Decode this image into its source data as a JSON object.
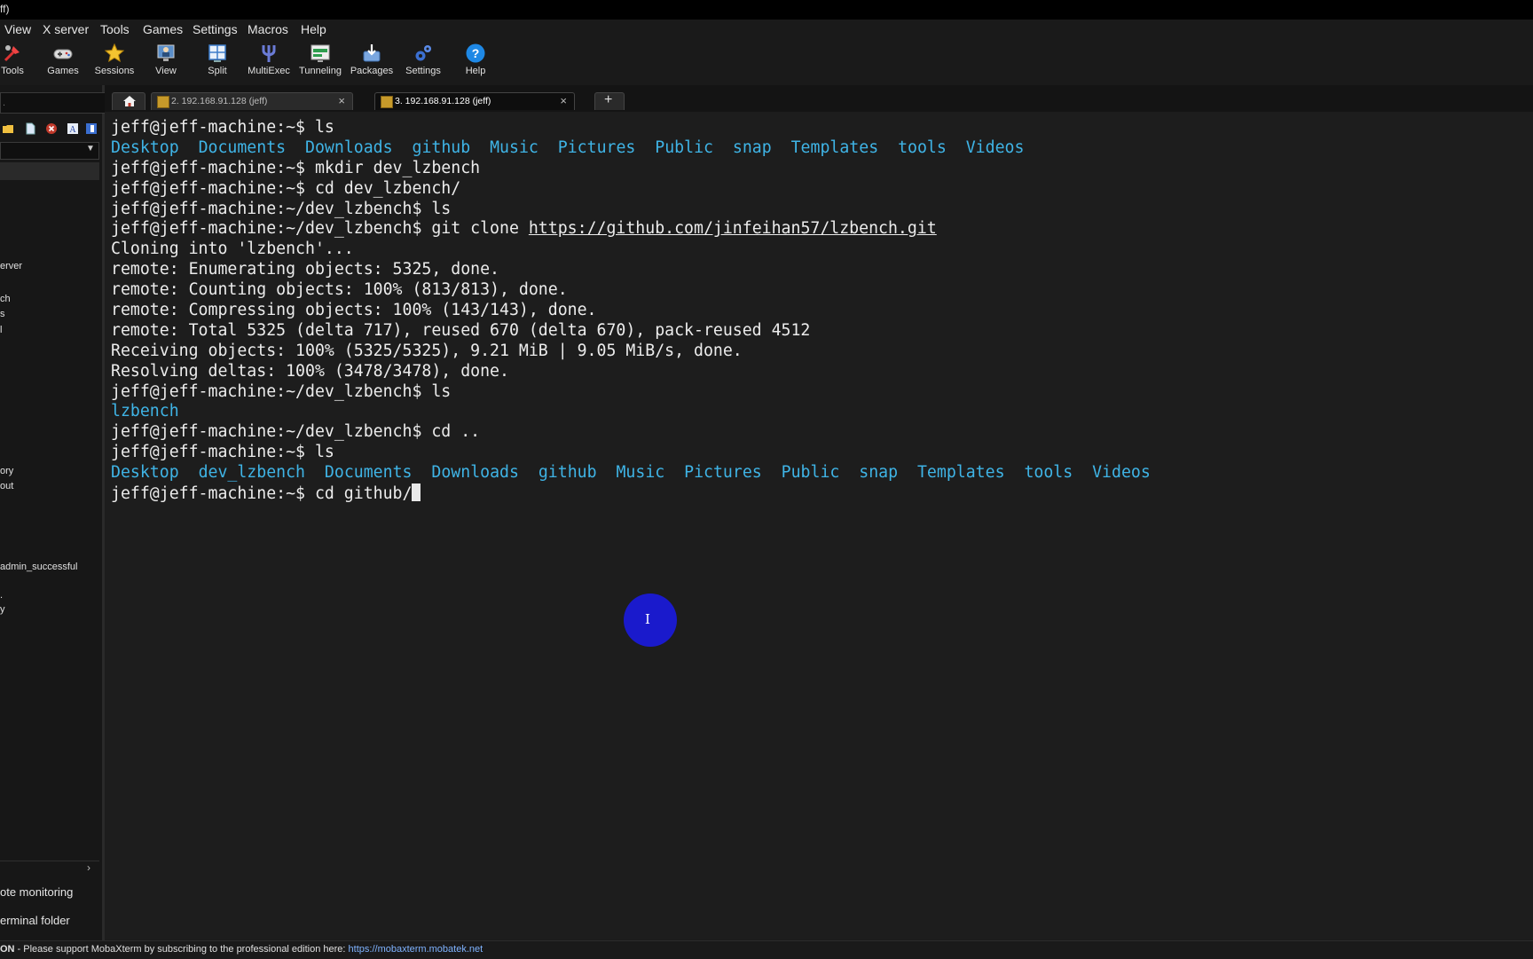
{
  "window": {
    "title_fragment": "ff)"
  },
  "menu": {
    "items": [
      "View",
      "X server",
      "Tools",
      "Games",
      "Settings",
      "Macros",
      "Help"
    ]
  },
  "toolbar": {
    "buttons": [
      {
        "label": "Tools",
        "icon": "tools-icon"
      },
      {
        "label": "Games",
        "icon": "gamepad-icon"
      },
      {
        "label": "Sessions",
        "icon": "star-icon"
      },
      {
        "label": "View",
        "icon": "monitor-user-icon"
      },
      {
        "label": "Split",
        "icon": "split-grid-icon"
      },
      {
        "label": "MultiExec",
        "icon": "fork-icon"
      },
      {
        "label": "Tunneling",
        "icon": "tunnel-icon"
      },
      {
        "label": "Packages",
        "icon": "download-package-icon"
      },
      {
        "label": "Settings",
        "icon": "gears-icon"
      },
      {
        "label": "Help",
        "icon": "help-icon"
      }
    ]
  },
  "sidebar": {
    "search_placeholder": ".",
    "fragments": [
      "erver",
      "ch",
      "s",
      "l",
      "ory",
      "out",
      "admin_successful",
      ".",
      "y"
    ],
    "bottom_items": [
      "ote monitoring",
      "erminal folder"
    ]
  },
  "tabs": [
    {
      "label": "2. 192.168.91.128 (jeff)",
      "active": false
    },
    {
      "label": "3. 192.168.91.128 (jeff)",
      "active": true
    }
  ],
  "terminal": {
    "colors": {
      "text": "#ececec",
      "dir": "#3fb4e6",
      "background": "#1d1d1d"
    },
    "lines": [
      [
        {
          "t": "jeff@jeff-machine:~$ ls"
        }
      ],
      [
        {
          "t": "Desktop",
          "c": "dir"
        },
        {
          "t": "  "
        },
        {
          "t": "Documents",
          "c": "dir"
        },
        {
          "t": "  "
        },
        {
          "t": "Downloads",
          "c": "dir"
        },
        {
          "t": "  "
        },
        {
          "t": "github",
          "c": "dir"
        },
        {
          "t": "  "
        },
        {
          "t": "Music",
          "c": "dir"
        },
        {
          "t": "  "
        },
        {
          "t": "Pictures",
          "c": "dir"
        },
        {
          "t": "  "
        },
        {
          "t": "Public",
          "c": "dir"
        },
        {
          "t": "  "
        },
        {
          "t": "snap",
          "c": "dir"
        },
        {
          "t": "  "
        },
        {
          "t": "Templates",
          "c": "dir"
        },
        {
          "t": "  "
        },
        {
          "t": "tools",
          "c": "dir"
        },
        {
          "t": "  "
        },
        {
          "t": "Videos",
          "c": "dir"
        }
      ],
      [
        {
          "t": "jeff@jeff-machine:~$ mkdir dev_lzbench"
        }
      ],
      [
        {
          "t": "jeff@jeff-machine:~$ cd dev_lzbench/"
        }
      ],
      [
        {
          "t": "jeff@jeff-machine:~/dev_lzbench$ ls"
        }
      ],
      [
        {
          "t": "jeff@jeff-machine:~/dev_lzbench$ git clone "
        },
        {
          "t": "https://github.com/jinfeihan57/lzbench.git",
          "c": "link"
        }
      ],
      [
        {
          "t": "Cloning into 'lzbench'..."
        }
      ],
      [
        {
          "t": "remote: Enumerating objects: 5325, done."
        }
      ],
      [
        {
          "t": "remote: Counting objects: 100% (813/813), done."
        }
      ],
      [
        {
          "t": "remote: Compressing objects: 100% (143/143), done."
        }
      ],
      [
        {
          "t": "remote: Total 5325 (delta 717), reused 670 (delta 670), pack-reused 4512"
        }
      ],
      [
        {
          "t": "Receiving objects: 100% (5325/5325), 9.21 MiB | 9.05 MiB/s, done."
        }
      ],
      [
        {
          "t": "Resolving deltas: 100% (3478/3478), done."
        }
      ],
      [
        {
          "t": "jeff@jeff-machine:~/dev_lzbench$ ls"
        }
      ],
      [
        {
          "t": "lzbench",
          "c": "dir"
        }
      ],
      [
        {
          "t": "jeff@jeff-machine:~/dev_lzbench$ cd .."
        }
      ],
      [
        {
          "t": "jeff@jeff-machine:~$ ls"
        }
      ],
      [
        {
          "t": "Desktop",
          "c": "dir"
        },
        {
          "t": "  "
        },
        {
          "t": "dev_lzbench",
          "c": "dir"
        },
        {
          "t": "  "
        },
        {
          "t": "Documents",
          "c": "dir"
        },
        {
          "t": "  "
        },
        {
          "t": "Downloads",
          "c": "dir"
        },
        {
          "t": "  "
        },
        {
          "t": "github",
          "c": "dir"
        },
        {
          "t": "  "
        },
        {
          "t": "Music",
          "c": "dir"
        },
        {
          "t": "  "
        },
        {
          "t": "Pictures",
          "c": "dir"
        },
        {
          "t": "  "
        },
        {
          "t": "Public",
          "c": "dir"
        },
        {
          "t": "  "
        },
        {
          "t": "snap",
          "c": "dir"
        },
        {
          "t": "  "
        },
        {
          "t": "Templates",
          "c": "dir"
        },
        {
          "t": "  "
        },
        {
          "t": "tools",
          "c": "dir"
        },
        {
          "t": "  "
        },
        {
          "t": "Videos",
          "c": "dir"
        }
      ],
      [
        {
          "t": "jeff@jeff-machine:~$ cd github/"
        }
      ]
    ]
  },
  "pointer": {
    "glyph": "I"
  },
  "status": {
    "prefix": "ON",
    "message": " - Please support MobaXterm by subscribing to the professional edition here: ",
    "url": "https://mobaxterm.mobatek.net"
  }
}
